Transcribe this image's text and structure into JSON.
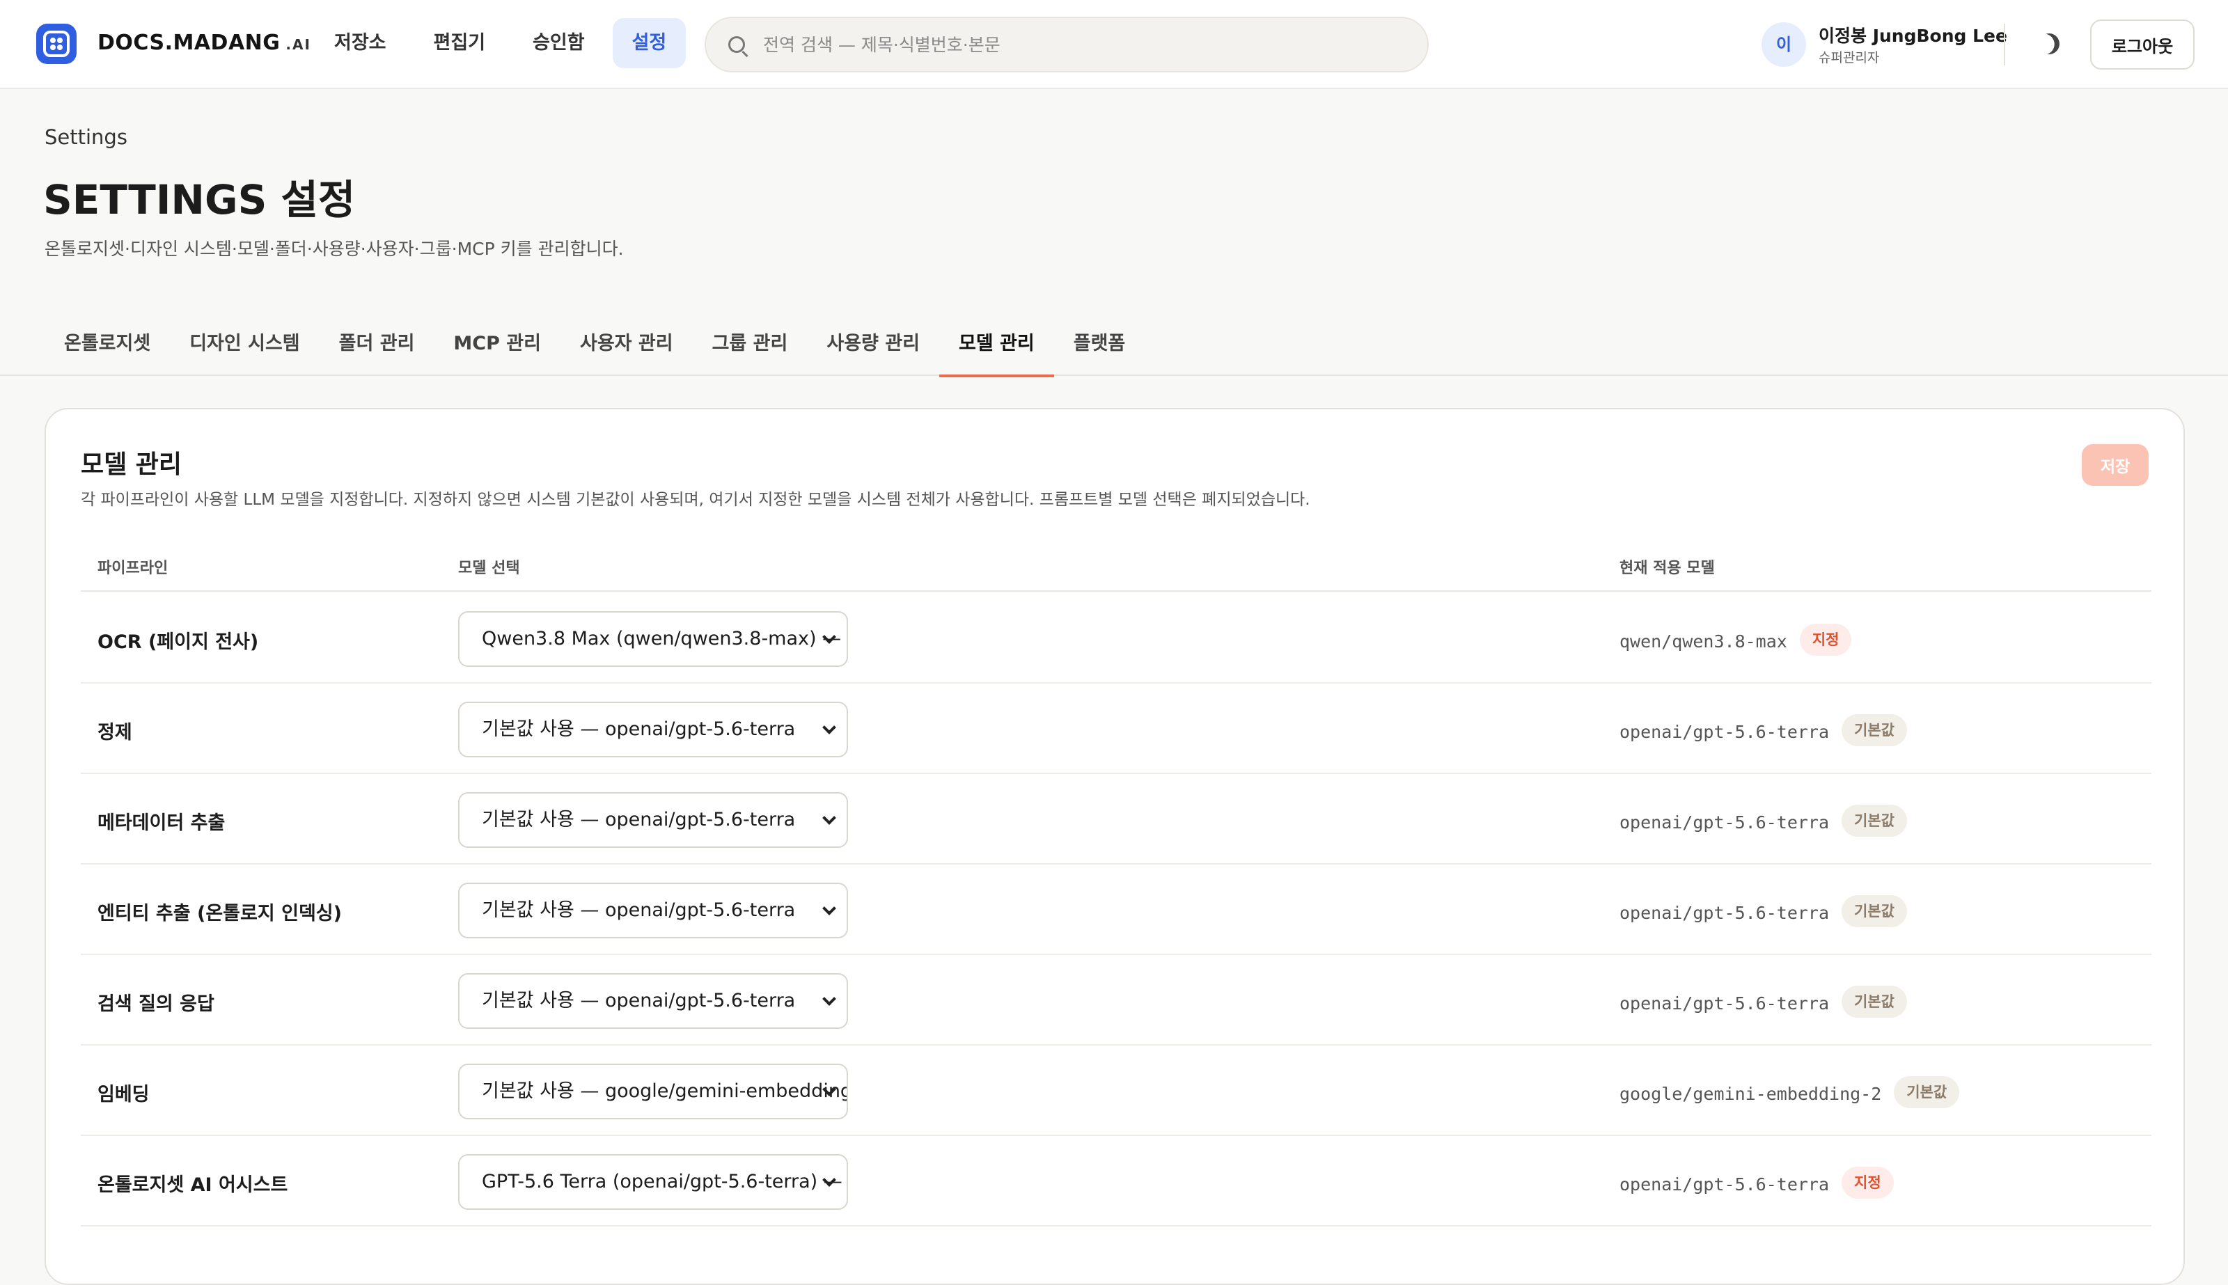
{
  "brand": {
    "name": "DOCS.MADANG",
    "suffix": ".AI"
  },
  "nav": [
    "저장소",
    "편집기",
    "승인함",
    "설정"
  ],
  "search": {
    "placeholder": "전역 검색 — 제목·식별번호·본문"
  },
  "user": {
    "initial": "이",
    "name": "이정봉 JungBong Lee",
    "role": "슈퍼관리자"
  },
  "logout_label": "로그아웃",
  "page": {
    "crumb": "Settings",
    "title": "SETTINGS 설정",
    "desc": "온톨로지셋·디자인 시스템·모델·폴더·사용량·사용자·그룹·MCP 키를 관리합니다."
  },
  "tabs": [
    "온톨로지셋",
    "디자인 시스템",
    "폴더 관리",
    "MCP 관리",
    "사용자 관리",
    "그룹 관리",
    "사용량 관리",
    "모델 관리",
    "플랫폼"
  ],
  "active_tab_index": 7,
  "card": {
    "title": "모델 관리",
    "desc": "각 파이프라인이 사용할 LLM 모델을 지정합니다. 지정하지 않으면 시스템 기본값이 사용되며, 여기서 지정한 모델을 시스템 전체가 사용합니다. 프롬프트별 모델 선택은 폐지되었습니다.",
    "save_label": "저장",
    "columns": [
      "파이프라인",
      "모델 선택",
      "현재 적용 모델"
    ],
    "rows": [
      {
        "pipeline": "OCR (페이지 전사)",
        "selected": "Qwen3.8 Max (qwen/qwen3.8-max) —",
        "current": "qwen/qwen3.8-max",
        "badge": "지정",
        "badge_kind": "set"
      },
      {
        "pipeline": "정제",
        "selected": "기본값 사용 — openai/gpt-5.6-terra",
        "current": "openai/gpt-5.6-terra",
        "badge": "기본값",
        "badge_kind": "def"
      },
      {
        "pipeline": "메타데이터 추출",
        "selected": "기본값 사용 — openai/gpt-5.6-terra",
        "current": "openai/gpt-5.6-terra",
        "badge": "기본값",
        "badge_kind": "def"
      },
      {
        "pipeline": "엔티티 추출 (온톨로지 인덱싱)",
        "selected": "기본값 사용 — openai/gpt-5.6-terra",
        "current": "openai/gpt-5.6-terra",
        "badge": "기본값",
        "badge_kind": "def"
      },
      {
        "pipeline": "검색 질의 응답",
        "selected": "기본값 사용 — openai/gpt-5.6-terra",
        "current": "openai/gpt-5.6-terra",
        "badge": "기본값",
        "badge_kind": "def"
      },
      {
        "pipeline": "임베딩",
        "selected": "기본값 사용 — google/gemini-embedding",
        "current": "google/gemini-embedding-2",
        "badge": "기본값",
        "badge_kind": "def"
      },
      {
        "pipeline": "온톨로지셋 AI 어시스트",
        "selected": "GPT-5.6 Terra (openai/gpt-5.6-terra) —",
        "current": "openai/gpt-5.6-terra",
        "badge": "지정",
        "badge_kind": "set"
      }
    ]
  }
}
